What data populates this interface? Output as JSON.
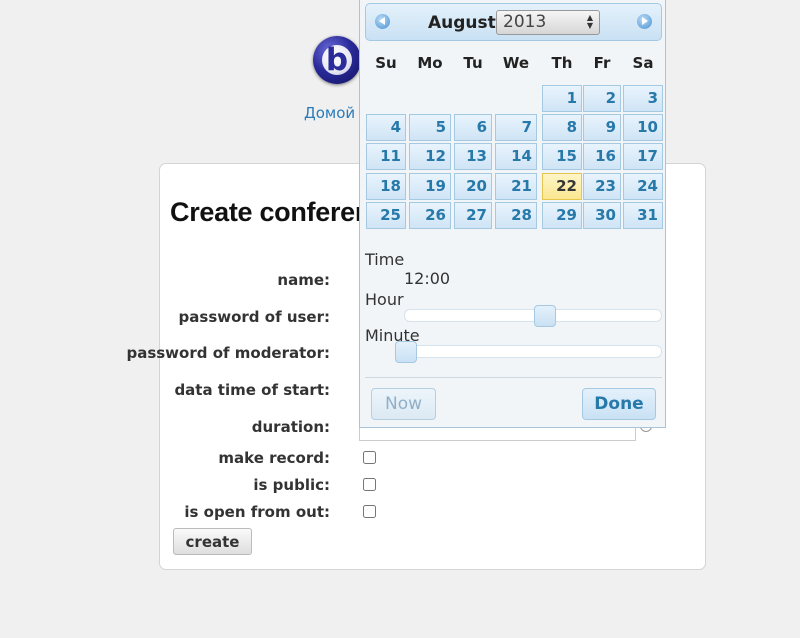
{
  "nav": {
    "home_label": "Домой"
  },
  "form": {
    "title": "Create conference",
    "labels": {
      "name": "name:",
      "password_user": "password of user:",
      "password_moderator": "password of moderator:",
      "start_time": "data time of start:",
      "duration": "duration:",
      "make_record": "make record:",
      "is_public": "is public:",
      "is_open": "is open from out:"
    },
    "checkboxes": {
      "make_record": false,
      "is_public": false,
      "is_open": false
    },
    "create_label": "create"
  },
  "datepicker": {
    "month": "August",
    "year": "2013",
    "weekdays": [
      "Su",
      "Mo",
      "Tu",
      "We",
      "Th",
      "Fr",
      "Sa"
    ],
    "first_weekday_index": 4,
    "days_in_month": 31,
    "highlighted_day": 22,
    "time_label": "Time",
    "time_value": "12:00",
    "hour_label": "Hour",
    "minute_label": "Minute",
    "hour_value": 12,
    "minute_value": 0,
    "now_label": "Now",
    "done_label": "Done"
  },
  "colors": {
    "link": "#2b7bb9",
    "day_text": "#2779aa",
    "today_bg": "#fbe790"
  }
}
